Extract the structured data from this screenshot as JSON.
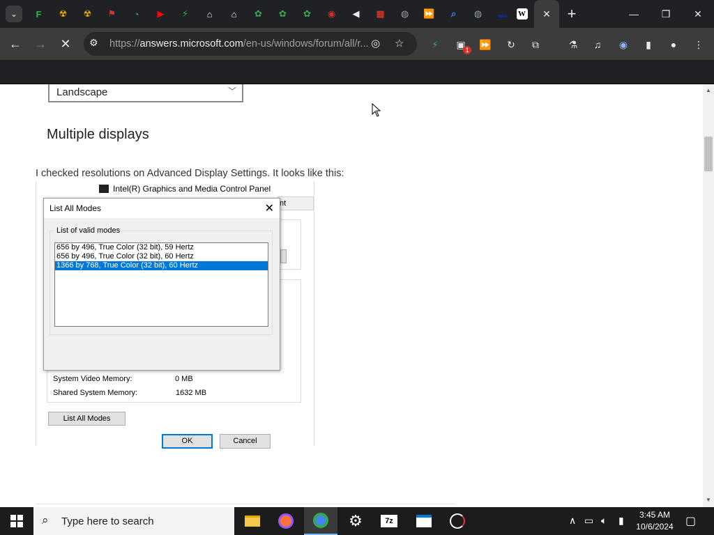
{
  "browser": {
    "tabs": [
      {
        "icon": "list-icon",
        "color": "#ffffff"
      },
      {
        "icon": "feedly-icon",
        "color": "#2bb24c"
      },
      {
        "icon": "biohazard-icon",
        "color": "#f4b400"
      },
      {
        "icon": "biohazard-icon",
        "color": "#f4b400"
      },
      {
        "icon": "flag-icon",
        "color": "#d93025"
      },
      {
        "icon": "timer-icon",
        "color": "#34a853"
      },
      {
        "icon": "youtube-icon",
        "color": "#ff0000"
      },
      {
        "icon": "bolt-icon",
        "color": "#34a853"
      },
      {
        "icon": "bank-icon",
        "color": "#e8eaed"
      },
      {
        "icon": "bank-icon",
        "color": "#e8eaed"
      },
      {
        "icon": "leaf-icon",
        "color": "#34a853"
      },
      {
        "icon": "leaf-icon",
        "color": "#34a853"
      },
      {
        "icon": "leaf-icon",
        "color": "#34a853"
      },
      {
        "icon": "record-icon",
        "color": "#d93025"
      },
      {
        "icon": "speaker-icon",
        "color": "#e8eaed"
      },
      {
        "icon": "grid-icon",
        "color": "#ea4335"
      },
      {
        "icon": "globe-icon",
        "color": "#9aa0a6"
      },
      {
        "icon": "forward-icon",
        "color": "#d93025"
      },
      {
        "icon": "search-icon",
        "color": "#4285f4"
      },
      {
        "icon": "globe-icon",
        "color": "#9aa0a6"
      },
      {
        "icon": "window-icon",
        "color": "#1a237e"
      }
    ],
    "active_tab_icon": "W",
    "url_host": "answers.microsoft.com",
    "url_path": "/en-us/windows/forum/all/r..."
  },
  "page": {
    "orientation_value": "Landscape",
    "heading": "Multiple displays",
    "paragraph": "I checked resolutions on Advanced Display Settings. It looks like this:",
    "screenshot": {
      "window_title": "Intel(R) Graphics and Media Control Panel",
      "tab_fragment": "nt",
      "video_memory_label": "System Video Memory:",
      "video_memory_value": "0 MB",
      "shared_memory_label": "Shared System Memory:",
      "shared_memory_value": "1632 MB",
      "list_all_modes_button": "List All Modes"
    },
    "dialog": {
      "title": "List All Modes",
      "group_label": "List of valid modes",
      "modes": [
        "656 by 496, True Color (32 bit), 59 Hertz",
        "656 by 496, True Color (32 bit), 60 Hertz",
        "1366 by 768, True Color (32 bit), 60 Hertz"
      ],
      "ok": "OK",
      "cancel": "Cancel"
    }
  },
  "taskbar": {
    "search_placeholder": "Type here to search",
    "time": "3:45 AM",
    "date": "10/6/2024"
  }
}
